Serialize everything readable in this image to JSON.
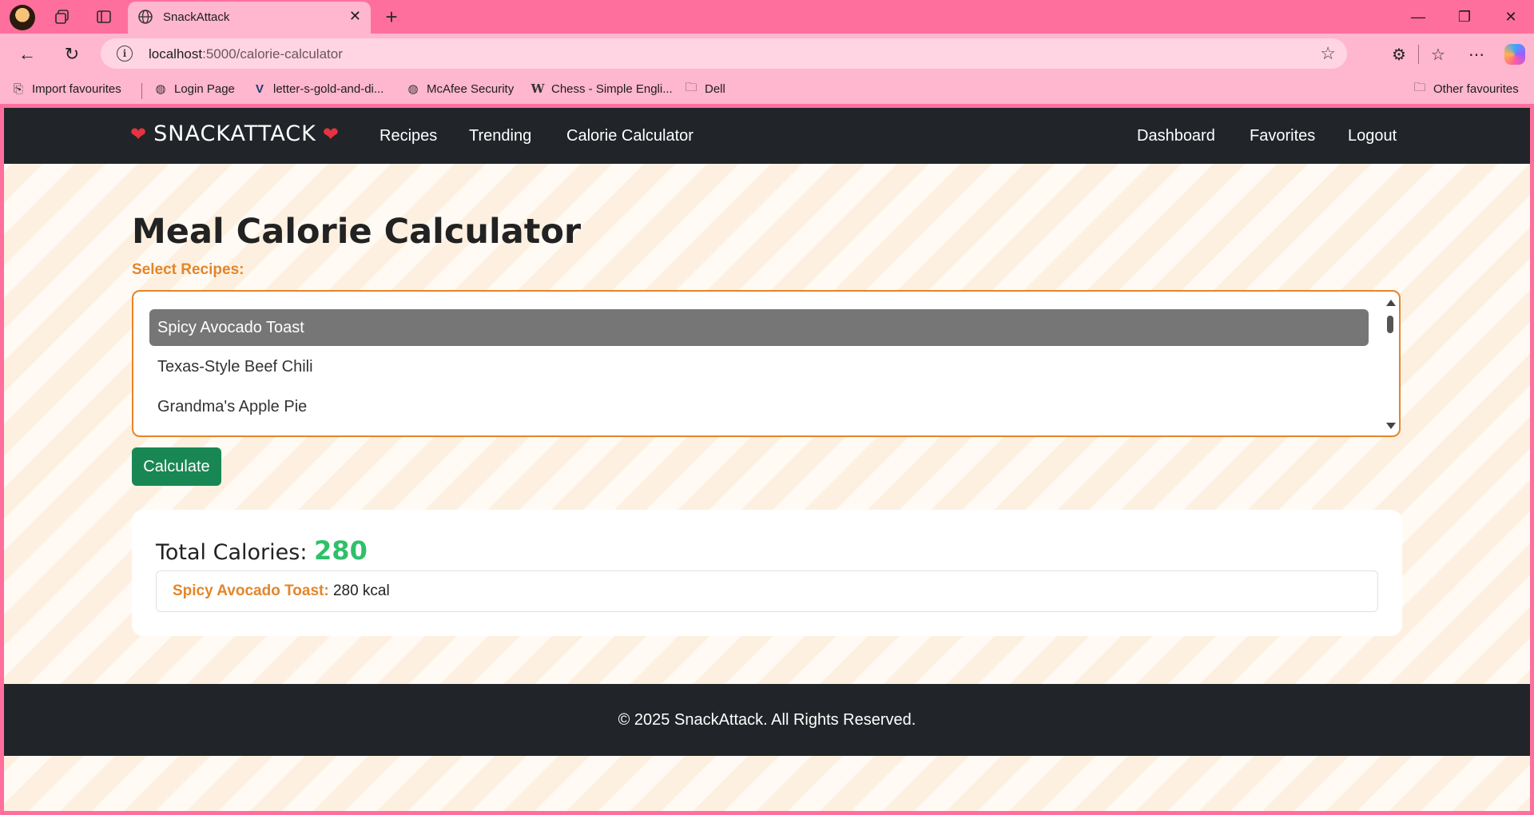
{
  "browser": {
    "tab_title": "SnackAttack",
    "url_host": "localhost",
    "url_path": ":5000/calorie-calculator",
    "favorites": [
      {
        "label": "Import favourites",
        "icon": "import-icon"
      },
      {
        "label": "Login Page",
        "icon": "globe-icon"
      },
      {
        "label": "letter-s-gold-and-di...",
        "icon": "v-logo-icon"
      },
      {
        "label": "McAfee Security",
        "icon": "globe-icon"
      },
      {
        "label": "Chess - Simple Engli...",
        "icon": "wikipedia-icon"
      },
      {
        "label": "Dell",
        "icon": "folder-icon"
      }
    ],
    "other_favorites": "Other favourites"
  },
  "site": {
    "brand": "SNACKATTACK",
    "nav_left": [
      "Recipes",
      "Trending",
      "Calorie Calculator"
    ],
    "nav_right": [
      "Dashboard",
      "Favorites",
      "Logout"
    ]
  },
  "main": {
    "title": "Meal Calorie Calculator",
    "select_label": "Select Recipes:",
    "recipes": [
      {
        "name": "Spicy Avocado Toast",
        "selected": true
      },
      {
        "name": "Texas-Style Beef Chili",
        "selected": false
      },
      {
        "name": "Grandma's Apple Pie",
        "selected": false
      }
    ],
    "calculate_label": "Calculate",
    "result": {
      "total_label": "Total Calories:",
      "total_value": "280",
      "items": [
        {
          "name": "Spicy Avocado Toast:",
          "value": "280 kcal"
        }
      ]
    }
  },
  "footer": {
    "text": "© 2025 SnackAttack. All Rights Reserved."
  },
  "colors": {
    "chrome": "#ff6f9d",
    "navbar": "#212529",
    "accent_orange": "#e4852a",
    "button_green": "#198754",
    "total_green": "#2fc06a"
  }
}
